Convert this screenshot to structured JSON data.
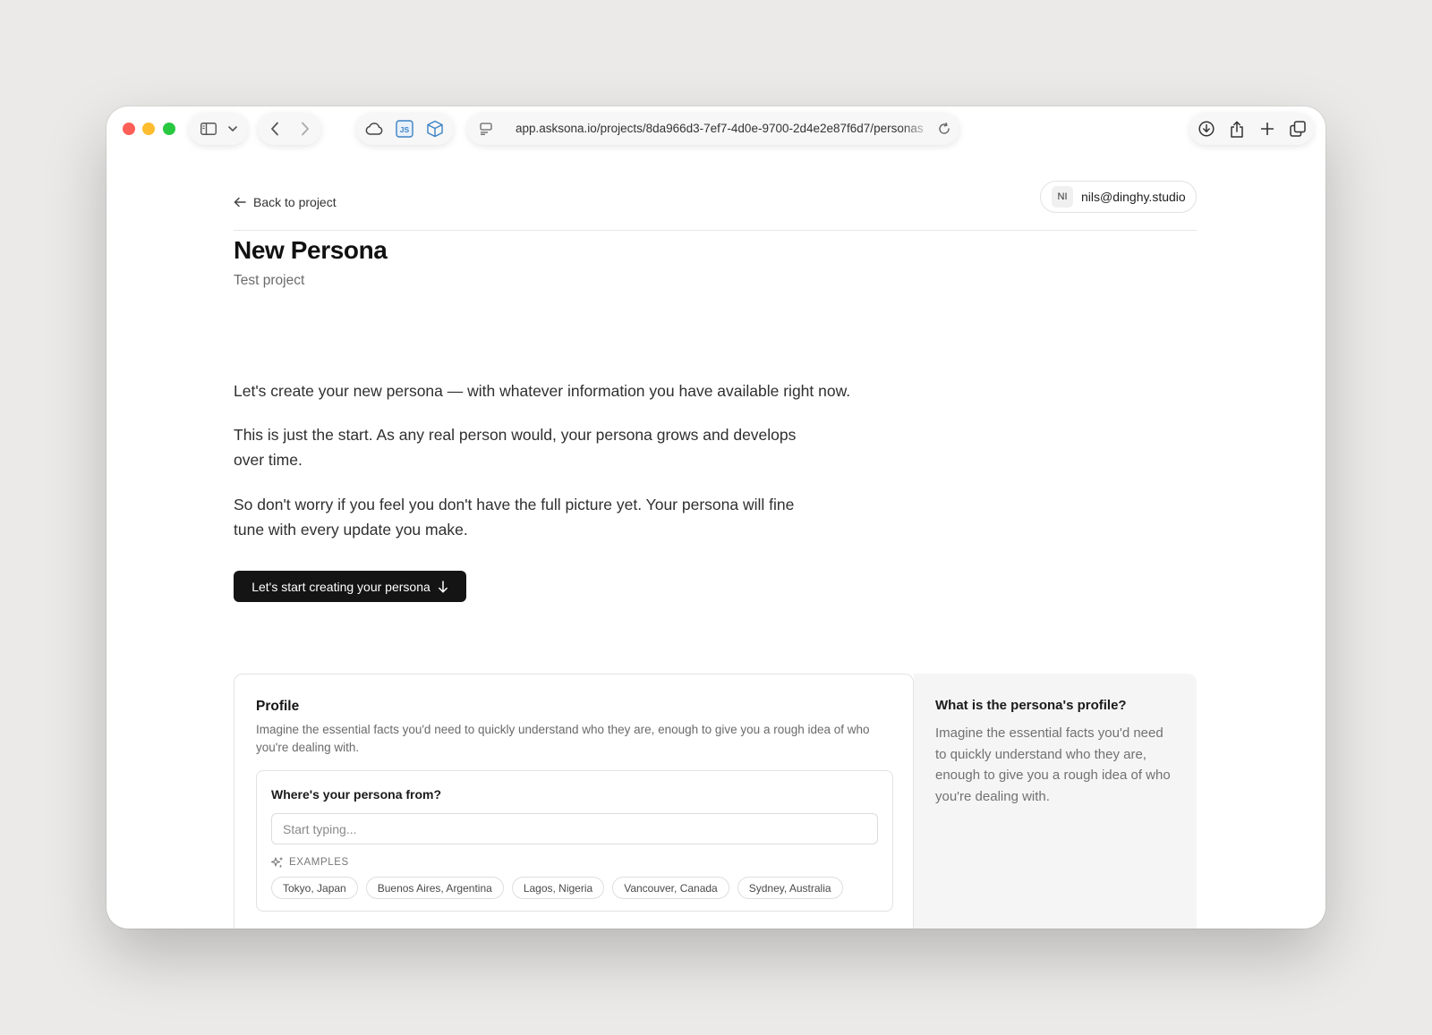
{
  "browser": {
    "url": "app.asksona.io/projects/8da966d3-7ef7-4d0e-9700-2d4e2e87f6d7/personas",
    "icons": [
      "sidebar-icon",
      "chevron-down-icon",
      "back-arrow-icon",
      "forward-arrow-icon",
      "cloud-icon",
      "js-extension-icon",
      "cube-extension-icon",
      "page-menu-icon",
      "reload-icon",
      "download-icon",
      "share-icon",
      "new-tab-icon",
      "tab-overview-icon"
    ]
  },
  "header": {
    "back_label": "Back to project",
    "user": {
      "initials": "NI",
      "email": "nils@dinghy.studio"
    }
  },
  "page": {
    "title": "New Persona",
    "subtitle": "Test project"
  },
  "intro": {
    "p1": "Let's create your new persona — with whatever information you have available right now.",
    "p2": "This is just the start. As any real person would, your persona grows and develops over time.",
    "p3": "So don't worry if you feel you don't have the full picture yet. Your persona will fine tune with every update you make.",
    "cta_label": "Let's start creating your persona"
  },
  "profile": {
    "title": "Profile",
    "description": "Imagine the essential facts you'd need to quickly understand who they are, enough to give you a rough idea of who you're dealing with.",
    "question": "Where's your persona from?",
    "input_placeholder": "Start typing...",
    "examples_label": "EXAMPLES",
    "examples": [
      "Tokyo, Japan",
      "Buenos Aires, Argentina",
      "Lagos, Nigeria",
      "Vancouver, Canada",
      "Sydney, Australia"
    ]
  },
  "help": {
    "title": "What is the persona's profile?",
    "body": "Imagine the essential facts you'd need to quickly understand who they are, enough to give you a rough idea of who you're dealing with."
  },
  "colors": {
    "background": "#ebeae8",
    "button_dark": "#141414",
    "help_panel": "#f5f5f5",
    "traffic_red": "#ff5f57",
    "traffic_yellow": "#febc2e",
    "traffic_green": "#28c840",
    "js_icon_blue": "#3b82c4"
  }
}
